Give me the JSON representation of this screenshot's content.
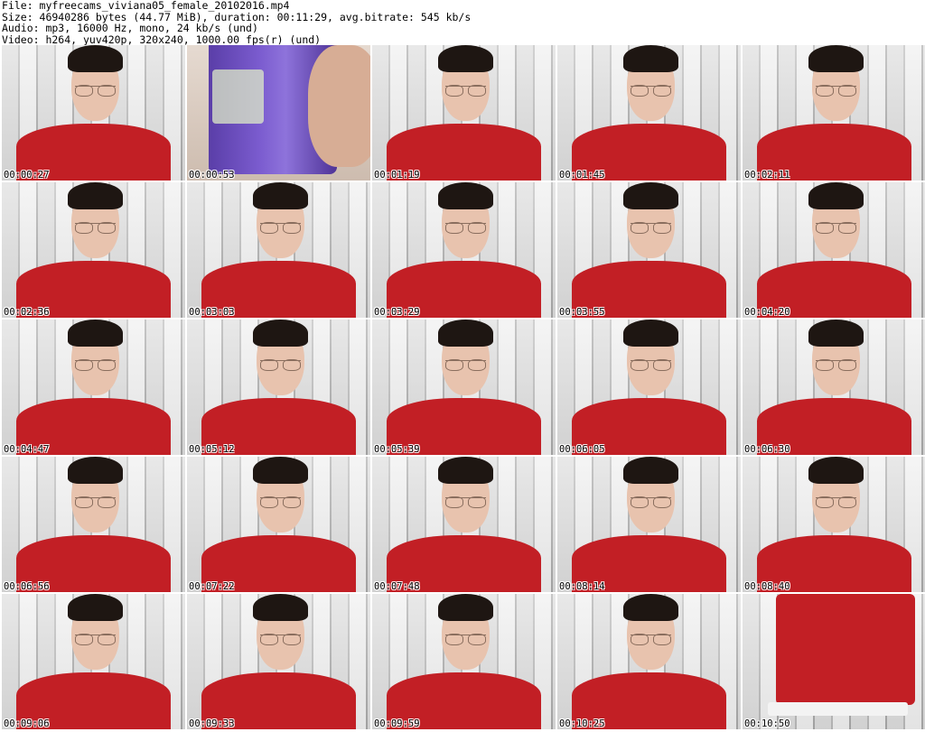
{
  "header": {
    "file": "File: myfreecams_viviana05_female_20102016.mp4",
    "size": "Size: 46940286 bytes (44.77 MiB), duration: 00:11:29, avg.bitrate: 545 kb/s",
    "audio": "Audio: mp3, 16000 Hz, mono, 24 kb/s (und)",
    "video": "Video: h264, yuv420p, 320x240, 1000.00 fps(r) (und)"
  },
  "thumbnails": [
    {
      "time": "00:00:27"
    },
    {
      "time": "00:00:53"
    },
    {
      "time": "00:01:19"
    },
    {
      "time": "00:01:45"
    },
    {
      "time": "00:02:11"
    },
    {
      "time": "00:02:36"
    },
    {
      "time": "00:03:03"
    },
    {
      "time": "00:03:29"
    },
    {
      "time": "00:03:55"
    },
    {
      "time": "00:04:20"
    },
    {
      "time": "00:04:47"
    },
    {
      "time": "00:05:12"
    },
    {
      "time": "00:05:39"
    },
    {
      "time": "00:06:05"
    },
    {
      "time": "00:06:30"
    },
    {
      "time": "00:06:56"
    },
    {
      "time": "00:07:22"
    },
    {
      "time": "00:07:48"
    },
    {
      "time": "00:08:14"
    },
    {
      "time": "00:08:40"
    },
    {
      "time": "00:09:06"
    },
    {
      "time": "00:09:33"
    },
    {
      "time": "00:09:59"
    },
    {
      "time": "00:10:25"
    },
    {
      "time": "00:10:50"
    }
  ]
}
